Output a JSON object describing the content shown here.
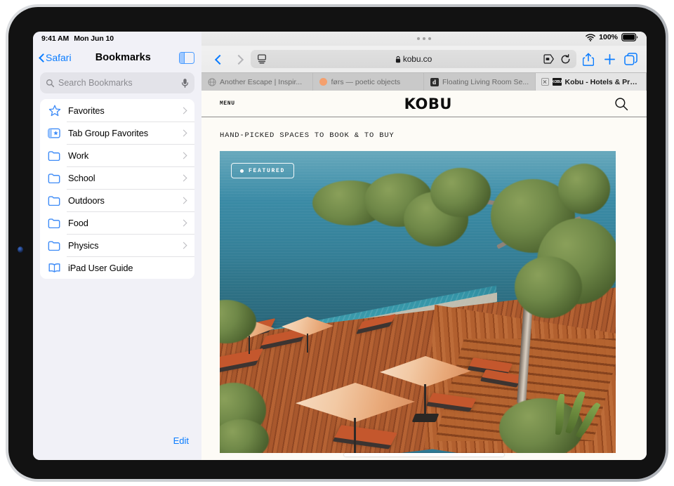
{
  "status_bar": {
    "time": "9:41 AM",
    "date": "Mon Jun 10",
    "battery_percent": "100%",
    "wifi_icon": "wifi-icon",
    "battery_icon": "battery-full-icon"
  },
  "sidebar": {
    "back_label": "Safari",
    "title": "Bookmarks",
    "toggle_icon": "sidebar-toggle-icon",
    "search": {
      "placeholder": "Search Bookmarks",
      "value": "",
      "search_icon": "search-icon",
      "mic_icon": "microphone-icon"
    },
    "items": [
      {
        "label": "Favorites",
        "icon": "star-icon",
        "chevron": true
      },
      {
        "label": "Tab Group Favorites",
        "icon": "tab-group-star-icon",
        "chevron": true
      },
      {
        "label": "Work",
        "icon": "folder-icon",
        "chevron": true
      },
      {
        "label": "School",
        "icon": "folder-icon",
        "chevron": true
      },
      {
        "label": "Outdoors",
        "icon": "folder-icon",
        "chevron": true
      },
      {
        "label": "Food",
        "icon": "folder-icon",
        "chevron": true
      },
      {
        "label": "Physics",
        "icon": "folder-icon",
        "chevron": true
      },
      {
        "label": "iPad User Guide",
        "icon": "book-icon",
        "chevron": false
      }
    ],
    "edit_label": "Edit"
  },
  "toolbar": {
    "back_icon": "back-arrow-icon",
    "forward_icon": "forward-arrow-icon",
    "reader_icon": "page-settings-icon",
    "url": "kobu.co",
    "lock_icon": "lock-icon",
    "extensions_icon": "extensions-icon",
    "reload_icon": "reload-icon",
    "share_icon": "share-icon",
    "new_tab_icon": "plus-icon",
    "tabs_overview_icon": "tabs-overview-icon"
  },
  "tabs": [
    {
      "title": "Another Escape | Inspir...",
      "favicon": "globe-icon",
      "active": false,
      "closable": false
    },
    {
      "title": "førs — poetic objects",
      "favicon": "orange-circle-favicon",
      "active": false,
      "closable": false
    },
    {
      "title": "Floating Living Room Se...",
      "favicon": "letter-d-favicon",
      "active": false,
      "closable": false
    },
    {
      "title": "Kobu - Hotels & Propert...",
      "favicon": "kobu-favicon",
      "active": true,
      "closable": true
    }
  ],
  "webpage": {
    "menu_label": "MENU",
    "logo": "KOBU",
    "search_icon": "site-search-icon",
    "tagline": "HAND-PICKED SPACES TO BOOK & TO BUY",
    "hero": {
      "badge_label": "FEATURED",
      "badge_dot": "bullet-dot",
      "alt": "Clifftop resort infinity pool with wooden deck, orange loungers and peach umbrellas overlooking the ocean"
    }
  },
  "colors": {
    "accent_blue": "#0a7cff",
    "sidebar_bg": "#f1f1f7",
    "page_bg": "#fdfbf6",
    "ocean": "#3a8aa3",
    "pool": "#41a9ba",
    "deck_wood": "#a9582d",
    "umbrella": "#eeb486",
    "lounger": "#c4572d"
  },
  "home_indicator": "home-indicator"
}
